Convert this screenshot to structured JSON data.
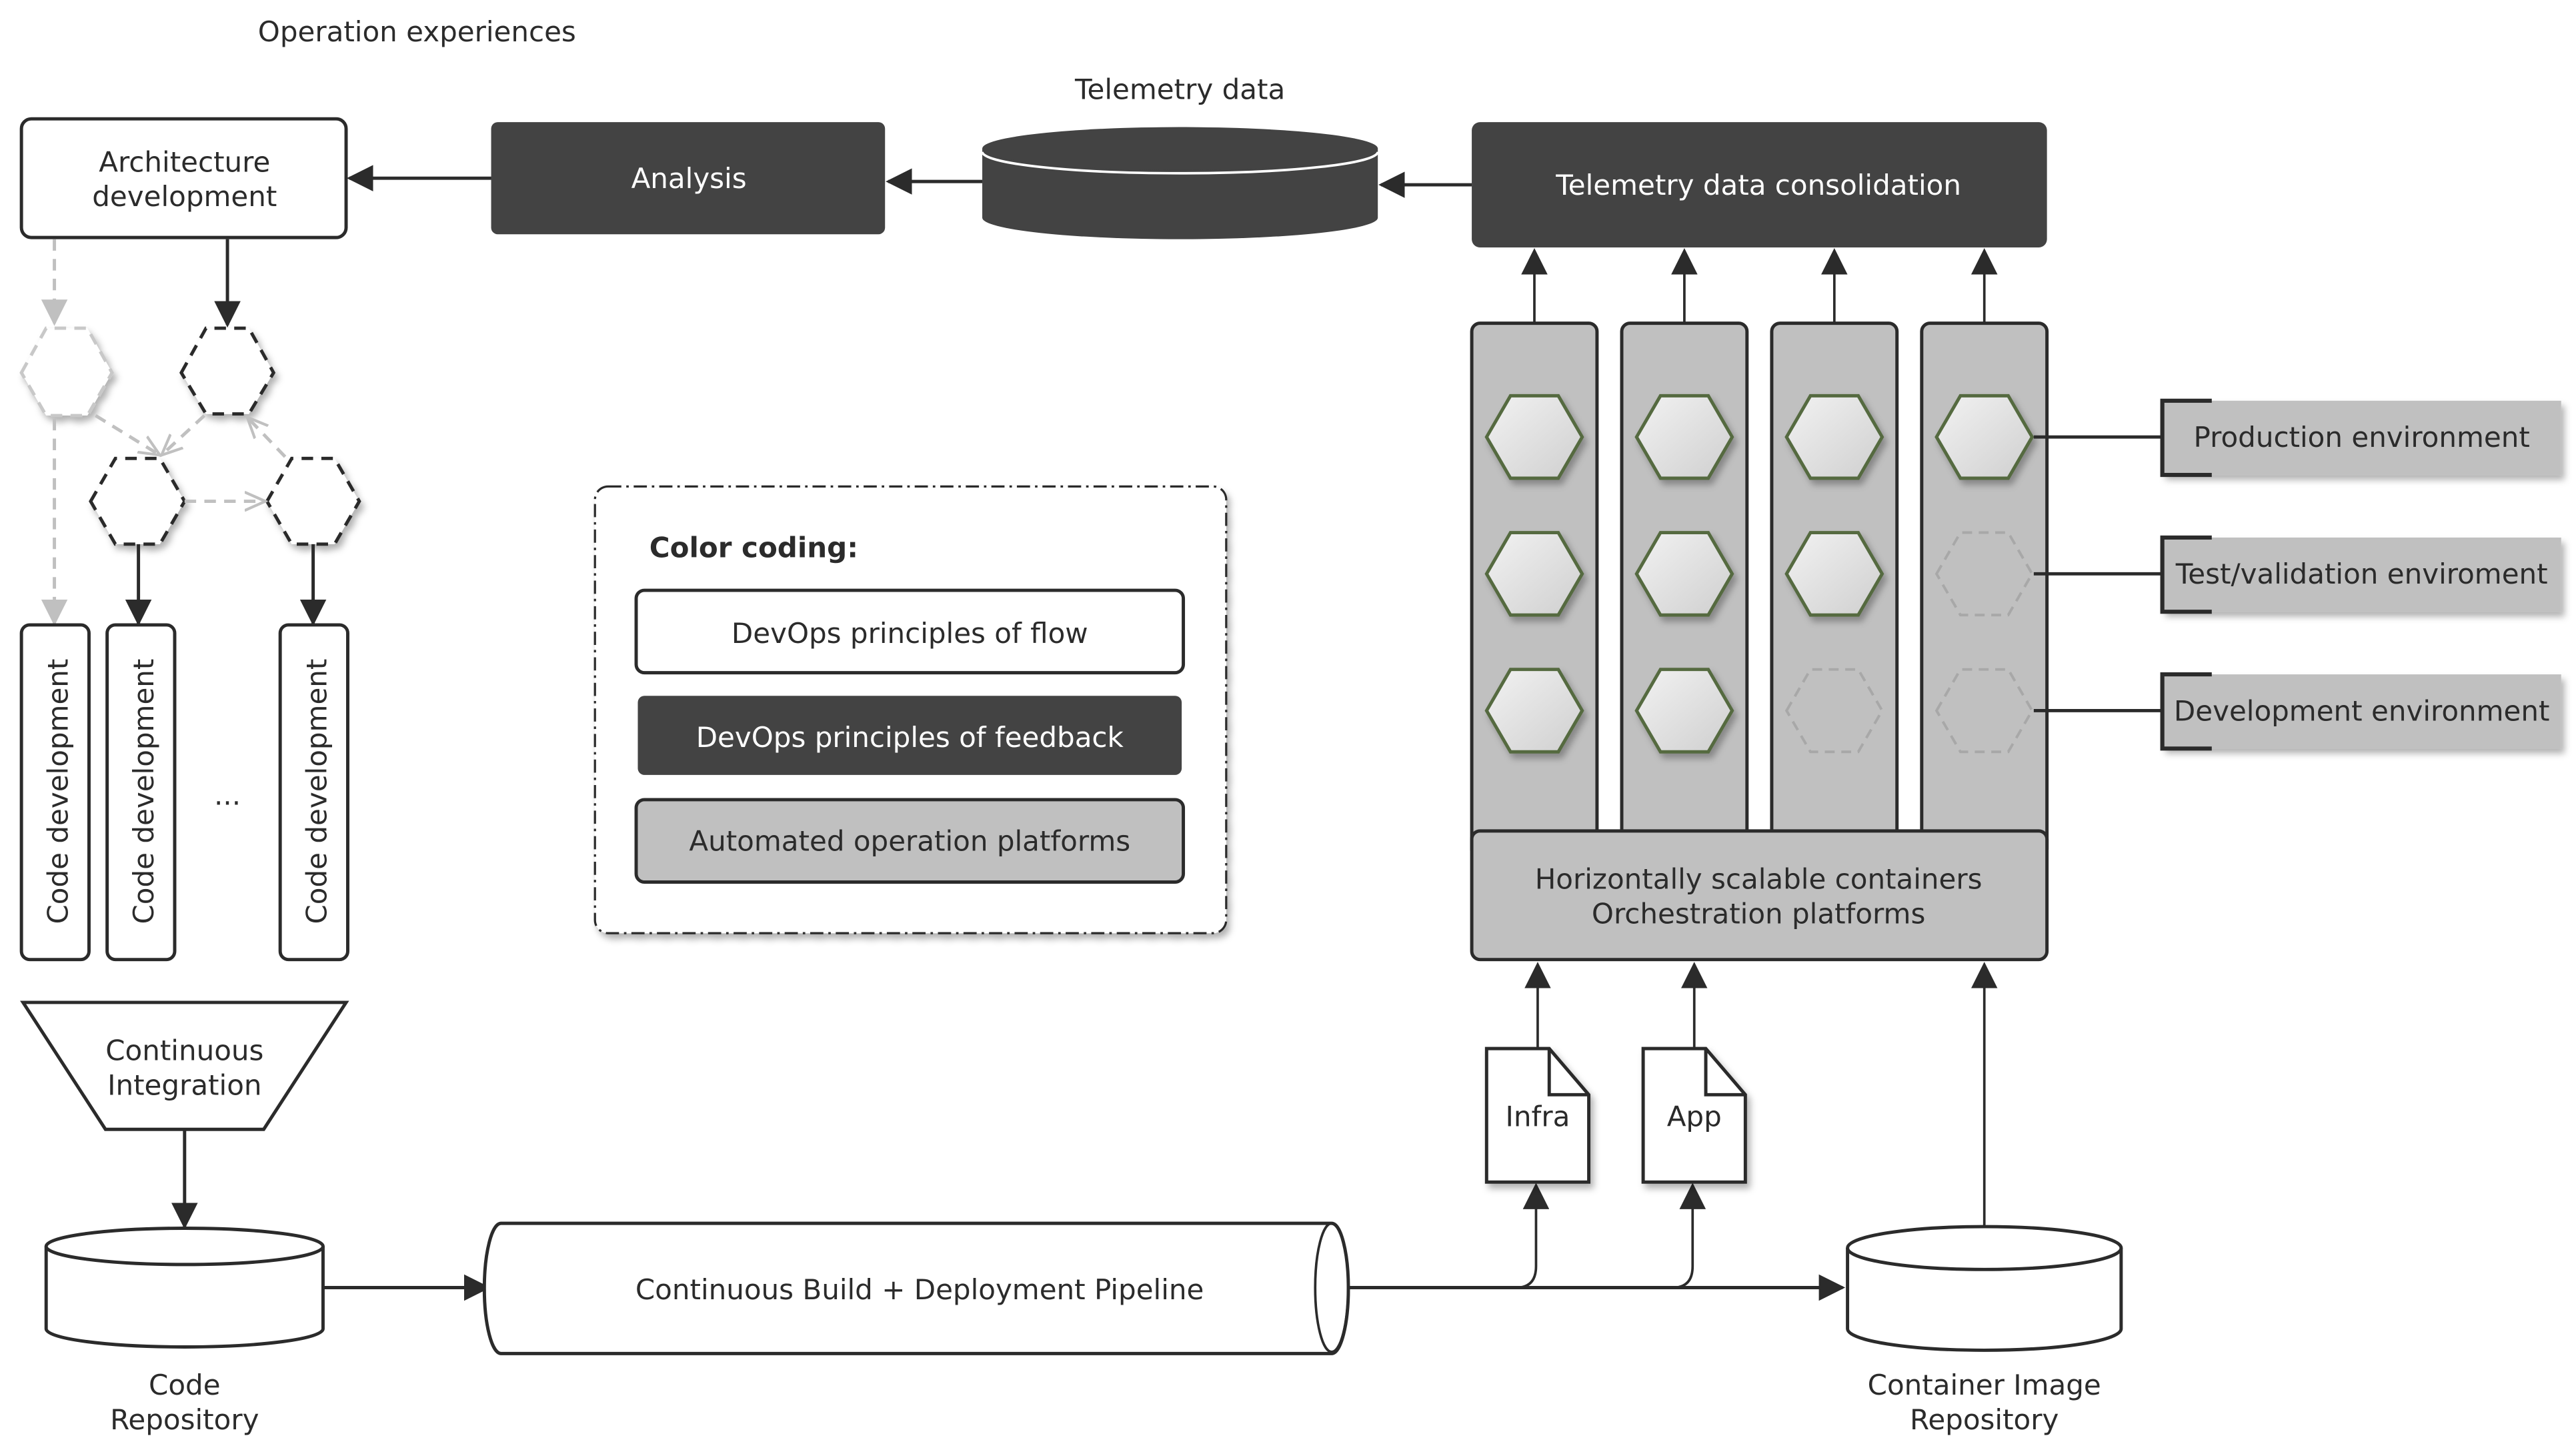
{
  "labels": {
    "operation_experiences": "Operation experiences",
    "telemetry_data": "Telemetry data",
    "architecture_development": [
      "Architecture",
      "development"
    ],
    "analysis": "Analysis",
    "telemetry_consolidation": "Telemetry data consolidation",
    "code_development": "Code development",
    "ellipsis": "...",
    "continuous_integration": [
      "Continuous",
      "Integration"
    ],
    "code_repository": [
      "Code",
      "Repository"
    ],
    "pipeline": "Continuous Build + Deployment Pipeline",
    "container_image_repository": [
      "Container Image",
      "Repository"
    ],
    "infra": "Infra",
    "app": "App",
    "orchestration": [
      "Horizontally scalable containers",
      "Orchestration platforms"
    ]
  },
  "environments": [
    {
      "label": "Production environment"
    },
    {
      "label": "Test/validation enviroment"
    },
    {
      "label": "Development environment"
    }
  ],
  "legend": {
    "title": "Color coding:",
    "items": [
      {
        "label": "DevOps principles of flow",
        "style": "white"
      },
      {
        "label": "DevOps principles of feedback",
        "style": "dark"
      },
      {
        "label": "Automated operation platforms",
        "style": "grey"
      }
    ]
  },
  "cluster_columns": [
    {
      "instances": [
        "active",
        "active",
        "active"
      ]
    },
    {
      "instances": [
        "active",
        "active",
        "active"
      ]
    },
    {
      "instances": [
        "active",
        "active",
        "inactive"
      ]
    },
    {
      "instances": [
        "active",
        "inactive",
        "inactive"
      ]
    }
  ],
  "colors": {
    "flow": "#ffffff",
    "feedback": "#434343",
    "platform": "#c0c0c0",
    "hex_border": "#556b3f"
  }
}
